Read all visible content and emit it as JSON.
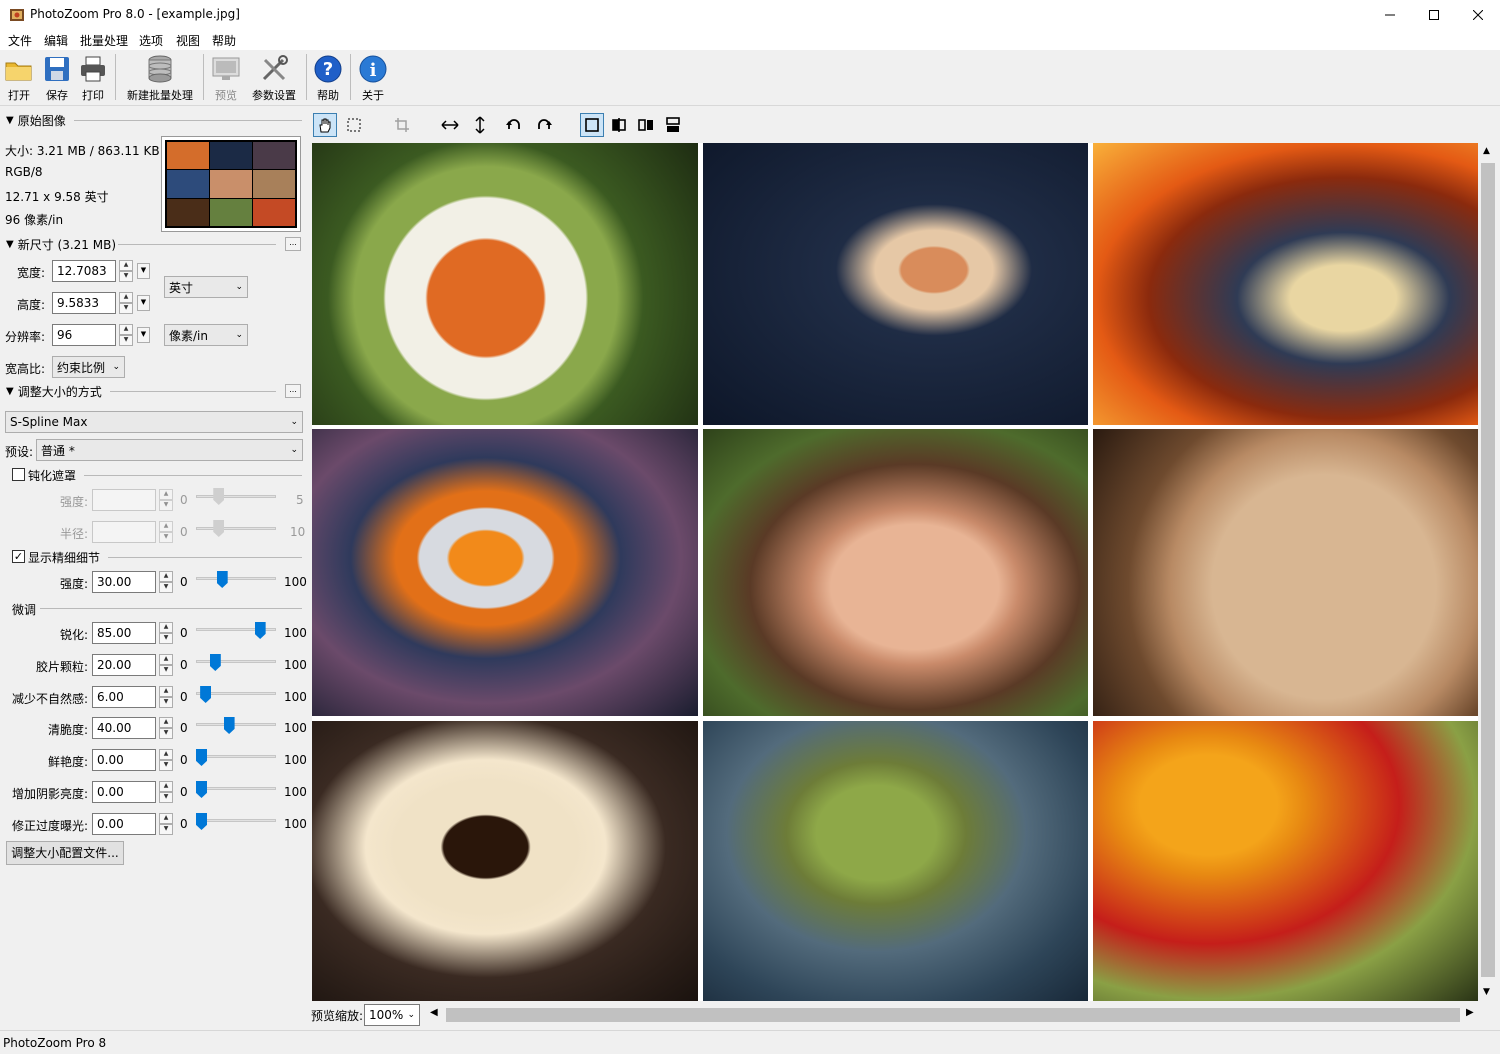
{
  "window": {
    "title": "PhotoZoom Pro 8.0 - [example.jpg]",
    "minimize": "minimize",
    "maximize": "maximize",
    "close": "close"
  },
  "menu": [
    "文件",
    "编辑",
    "批量处理",
    "选项",
    "视图",
    "帮助"
  ],
  "toolbar": {
    "open": "打开",
    "save": "保存",
    "print": "打印",
    "new_batch": "新建批量处理",
    "preview": "预览",
    "settings": "参数设置",
    "help": "帮助",
    "about": "关于"
  },
  "original": {
    "header": "原始图像",
    "size": "大小: 3.21 MB / 863.11 KB",
    "mode": "RGB/8",
    "dims": "12.71 x 9.58 英寸",
    "res": "96 像素/in"
  },
  "new_size": {
    "header": "新尺寸 (3.21 MB)",
    "width_label": "宽度:",
    "width_value": "12.7083",
    "height_label": "高度:",
    "height_value": "9.5833",
    "res_label": "分辨率:",
    "res_value": "96",
    "unit": "英寸",
    "res_unit": "像素/in",
    "aspect_label": "宽高比:",
    "aspect_value": "约束比例"
  },
  "method": {
    "header": "调整大小的方式",
    "algorithm": "S-Spline Max",
    "preset_label": "预设:",
    "preset_value": "普通 *"
  },
  "unsharp": {
    "label": "钝化遮罩",
    "checked": false,
    "rows": [
      {
        "label": "强度:",
        "min": "0",
        "max": "5",
        "level": 0.25
      },
      {
        "label": "半径:",
        "min": "0",
        "max": "10",
        "level": 0.25
      }
    ]
  },
  "detail": {
    "label": "显示精细细节",
    "checked": true,
    "rows": [
      {
        "label": "强度:",
        "value": "30.00",
        "min": "0",
        "max": "100",
        "level": 0.3
      }
    ]
  },
  "finetune": {
    "header": "微调",
    "rows": [
      {
        "label": "锐化:",
        "value": "85.00",
        "min": "0",
        "max": "100",
        "level": 0.85
      },
      {
        "label": "胶片颗粒:",
        "value": "20.00",
        "min": "0",
        "max": "100",
        "level": 0.2
      },
      {
        "label": "减少不自然感:",
        "value": "6.00",
        "min": "0",
        "max": "100",
        "level": 0.06
      },
      {
        "label": "清脆度:",
        "value": "40.00",
        "min": "0",
        "max": "100",
        "level": 0.4
      },
      {
        "label": "鲜艳度:",
        "value": "0.00",
        "min": "0",
        "max": "100",
        "level": 0.0
      },
      {
        "label": "增加阴影亮度:",
        "value": "0.00",
        "min": "0",
        "max": "100",
        "level": 0.0
      },
      {
        "label": "修正过度曝光:",
        "value": "0.00",
        "min": "0",
        "max": "100",
        "level": 0.0
      }
    ],
    "profile_button": "调整大小配置文件..."
  },
  "tiles": [
    "food-bowl",
    "seashell",
    "grilled-potatoes",
    "butterflyfish",
    "smiling-woman",
    "antique-clock",
    "coffee-cup",
    "frog",
    "fruit-strawberries"
  ],
  "zoom": {
    "label": "预览缩放:",
    "value": "100%"
  },
  "status": "PhotoZoom Pro 8",
  "colors": {
    "accent": "#0078d7",
    "toolbar_bg": "#f0f0f0",
    "help_blue": "#1f5fc8"
  }
}
